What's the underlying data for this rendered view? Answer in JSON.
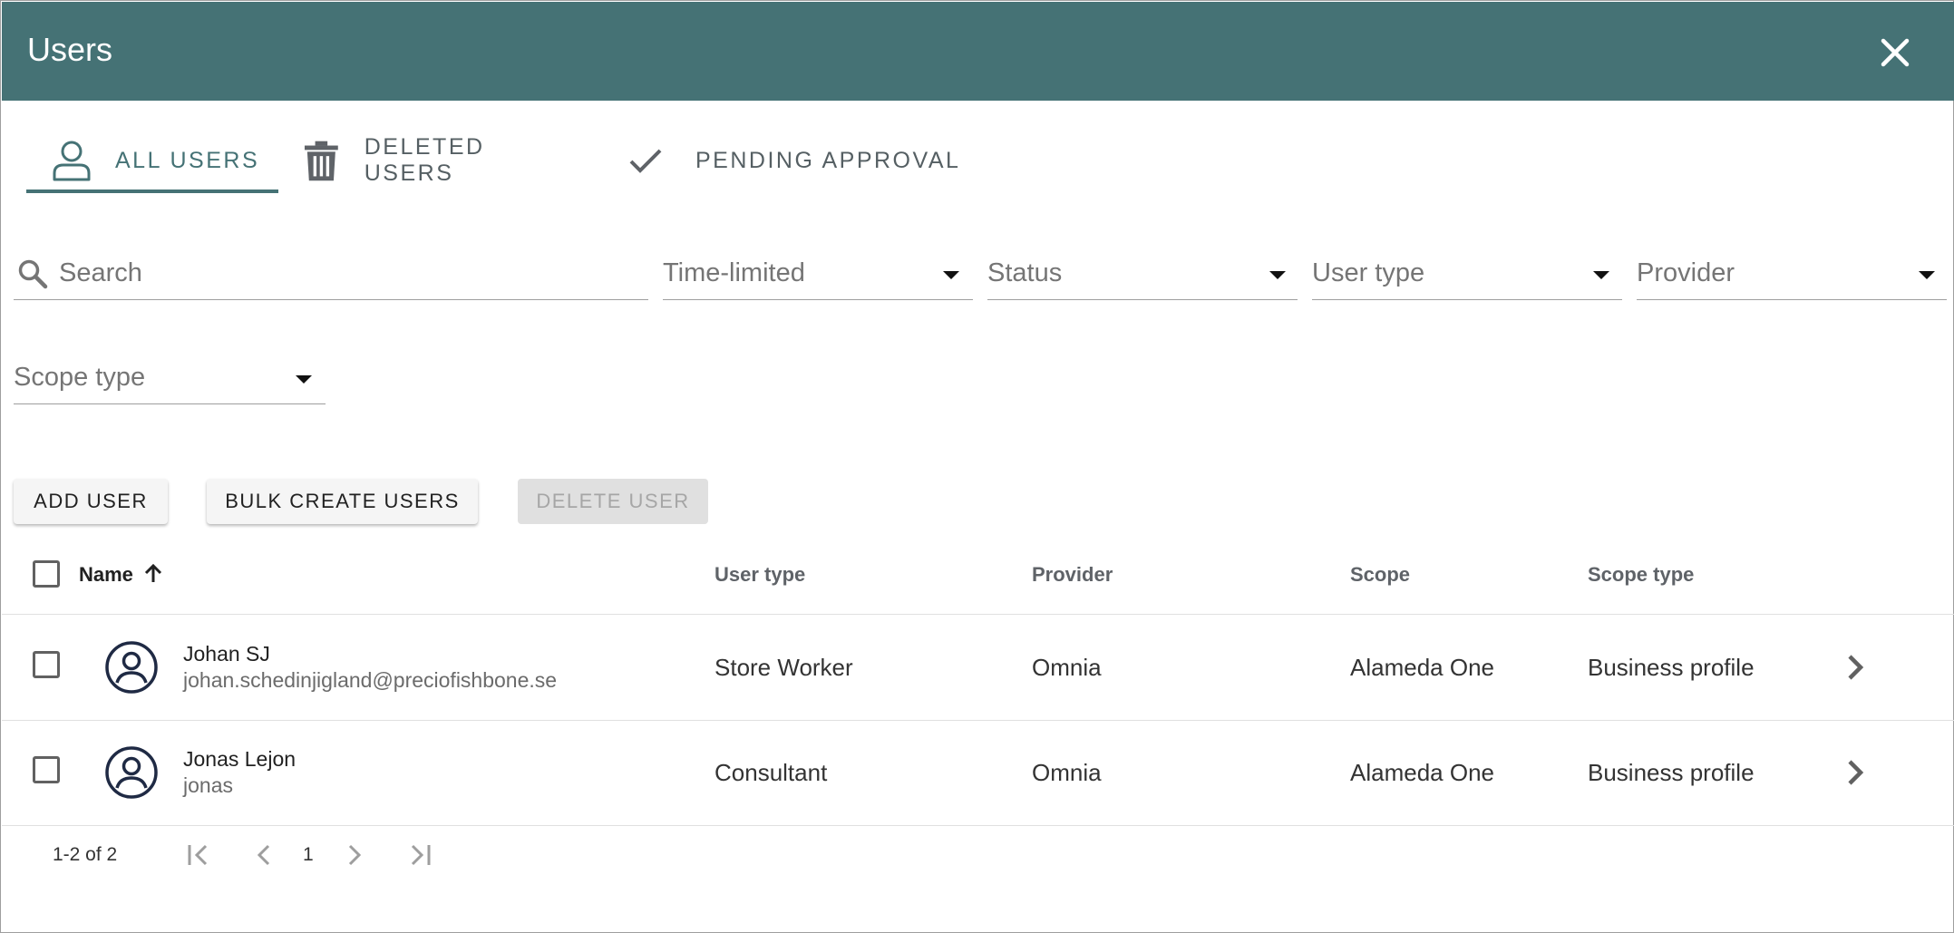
{
  "dialog": {
    "title": "Users"
  },
  "tabs": [
    {
      "label": "ALL USERS",
      "icon": "person-outline-icon",
      "active": true
    },
    {
      "label": "DELETED USERS",
      "icon": "trash-icon",
      "active": false
    },
    {
      "label": "PENDING APPROVAL",
      "icon": "check-icon",
      "active": false
    }
  ],
  "filters": {
    "search_placeholder": "Search",
    "time_limited": "Time-limited",
    "status": "Status",
    "user_type": "User type",
    "provider": "Provider",
    "scope_type": "Scope type"
  },
  "actions": {
    "add_user": "ADD USER",
    "bulk_create": "BULK CREATE USERS",
    "delete_user": "DELETE USER"
  },
  "table": {
    "columns": {
      "name": "Name",
      "user_type": "User type",
      "provider": "Provider",
      "scope": "Scope",
      "scope_type": "Scope type"
    },
    "sort": {
      "column": "name",
      "direction": "ascending"
    },
    "rows": [
      {
        "name": "Johan SJ",
        "email": "johan.schedinjigland@preciofishbone.se",
        "user_type": "Store Worker",
        "provider": "Omnia",
        "scope": "Alameda One",
        "scope_type": "Business profile"
      },
      {
        "name": "Jonas Lejon",
        "email": "jonas",
        "user_type": "Consultant",
        "provider": "Omnia",
        "scope": "Alameda One",
        "scope_type": "Business profile"
      }
    ]
  },
  "pagination": {
    "range": "1-2 of 2",
    "page": "1"
  },
  "colors": {
    "header": "#457275",
    "accent": "#457275",
    "avatar": "#1f2a44"
  }
}
